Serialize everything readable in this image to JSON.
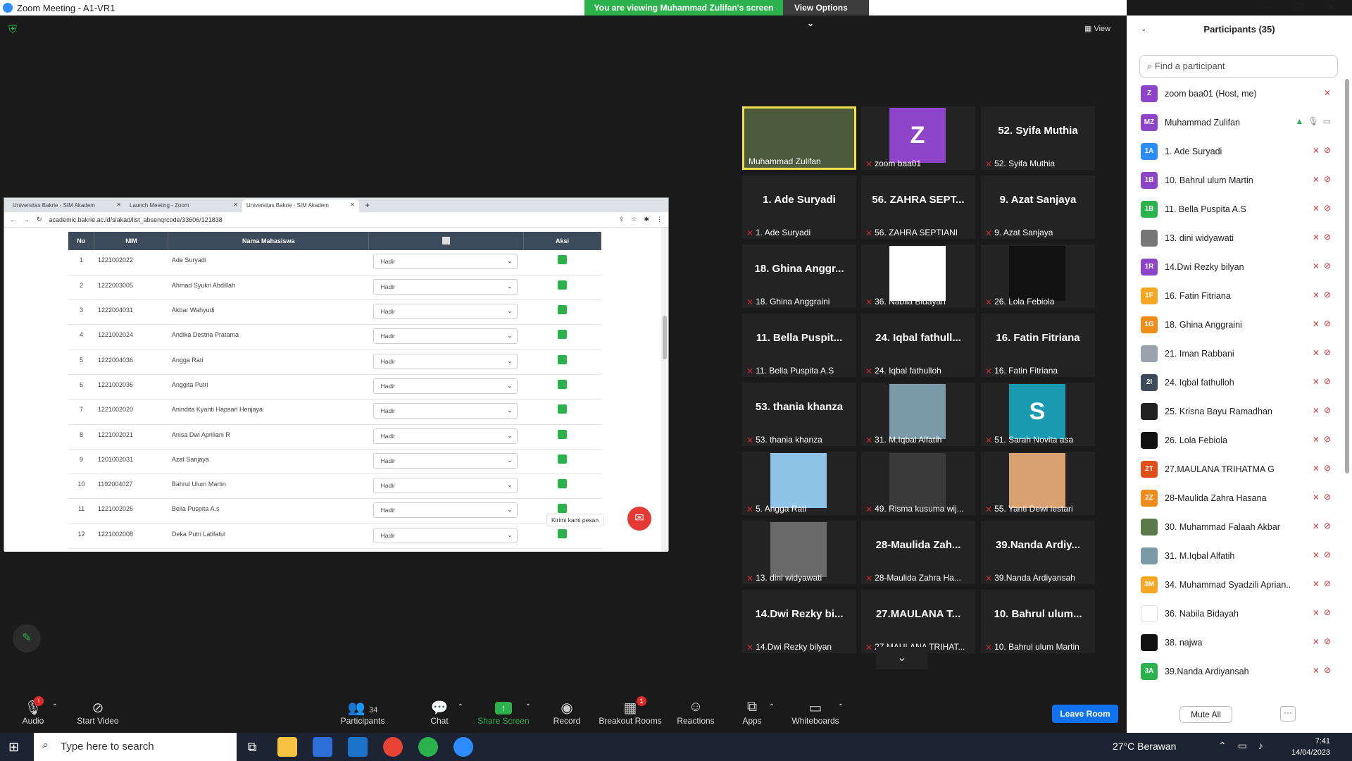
{
  "window": {
    "title": "Zoom Meeting - A1-VR1"
  },
  "share_bar": {
    "viewing_text": "You are viewing Muhammad Zulifan's screen",
    "view_options": "View Options"
  },
  "top_view_button": "View",
  "browser": {
    "tabs": [
      "Universitas Bakrie - SIM Akadem",
      "Launch Meeting - Zoom",
      "Universitas Bakrie - SIM Akadem"
    ],
    "url": "academic.bakrie.ac.id/siakad/list_absenqrcode/33606/121838",
    "table_headers": [
      "No",
      "NIM",
      "Nama Mahasiswa",
      "",
      "Aksi"
    ],
    "rows": [
      {
        "no": "1",
        "nim": "1221002022",
        "nama": "Ade Suryadi",
        "status": "Hadir"
      },
      {
        "no": "2",
        "nim": "1222003005",
        "nama": "Ahmad Syukri Abdillah",
        "status": "Hadir"
      },
      {
        "no": "3",
        "nim": "1222004031",
        "nama": "Akbar Wahyudi",
        "status": "Hadir"
      },
      {
        "no": "4",
        "nim": "1221002024",
        "nama": "Andika Destria Pratama",
        "status": "Hadir"
      },
      {
        "no": "5",
        "nim": "1222004036",
        "nama": "Angga Rati",
        "status": "Hadir"
      },
      {
        "no": "6",
        "nim": "1221002036",
        "nama": "Anggita Putri",
        "status": "Hadir"
      },
      {
        "no": "7",
        "nim": "1221002020",
        "nama": "Anindita Kyanti Hapsari Henjaya",
        "status": "Hadir"
      },
      {
        "no": "8",
        "nim": "1221002021",
        "nama": "Anisa Dwi Apriliani R",
        "status": "Hadir"
      },
      {
        "no": "9",
        "nim": "1201002031",
        "nama": "Azat Sanjaya",
        "status": "Hadir"
      },
      {
        "no": "10",
        "nim": "1192004027",
        "nama": "Bahrul Ulum Martin",
        "status": "Hadir"
      },
      {
        "no": "11",
        "nim": "1221002026",
        "nama": "Bella Puspita A.s",
        "status": "Hadir"
      },
      {
        "no": "12",
        "nim": "1221002008",
        "nama": "Deka Putri Latifatul",
        "status": "Hadir"
      }
    ],
    "chat_tooltip": "Kirimi kami pesan"
  },
  "video_tiles": [
    {
      "big": "",
      "label": "Muhammad Zulifan",
      "kind": "photo",
      "color": "#4a5a3a"
    },
    {
      "big": "Z",
      "label": "zoom baa01",
      "kind": "avatar",
      "color": "#8e44c9"
    },
    {
      "big": "52. Syifa Muthia",
      "label": "52. Syifa Muthia",
      "kind": "name"
    },
    {
      "big": "1. Ade Suryadi",
      "label": "1. Ade Suryadi",
      "kind": "name"
    },
    {
      "big": "56. ZAHRA SEPT...",
      "label": "56. ZAHRA SEPTIANI",
      "kind": "name"
    },
    {
      "big": "9. Azat Sanjaya",
      "label": "9. Azat Sanjaya",
      "kind": "name"
    },
    {
      "big": "18. Ghina Anggr...",
      "label": "18. Ghina Anggraini",
      "kind": "name"
    },
    {
      "big": "",
      "label": "36. Nabila Bidayah",
      "kind": "photo",
      "color": "#ffffff"
    },
    {
      "big": "",
      "label": "26. Lola Febiola",
      "kind": "photo",
      "color": "#111111"
    },
    {
      "big": "11. Bella Puspit...",
      "label": "11. Bella Puspita A.S",
      "kind": "name"
    },
    {
      "big": "24. Iqbal fathull...",
      "label": "24. Iqbal fathulloh",
      "kind": "name"
    },
    {
      "big": "16. Fatin Fitriana",
      "label": "16. Fatin Fitriana",
      "kind": "name"
    },
    {
      "big": "53. thania khanza",
      "label": "53. thania khanza",
      "kind": "name"
    },
    {
      "big": "",
      "label": "31. M.Iqbal Alfatih",
      "kind": "photo",
      "color": "#7a9aa8"
    },
    {
      "big": "S",
      "label": "51. Sarah Novita asa",
      "kind": "avatar",
      "color": "#1a9ab0"
    },
    {
      "big": "",
      "label": "5. Angga Rati",
      "kind": "photo",
      "color": "#8fc3e8"
    },
    {
      "big": "",
      "label": "49. Risma kusuma wij...",
      "kind": "photo",
      "color": "#3a3a3a"
    },
    {
      "big": "",
      "label": "55. Yanti Dewi lestari",
      "kind": "photo",
      "color": "#d9a070"
    },
    {
      "big": "",
      "label": "13. dini widyawati",
      "kind": "photo",
      "color": "#6a6a6a"
    },
    {
      "big": "28-Maulida Zah...",
      "label": "28-Maulida Zahra Ha...",
      "kind": "name"
    },
    {
      "big": "39.Nanda Ardiy...",
      "label": "39.Nanda Ardiyansah",
      "kind": "name"
    },
    {
      "big": "14.Dwi Rezky bi...",
      "label": "14.Dwi Rezky bilyan",
      "kind": "name"
    },
    {
      "big": "27.MAULANA T...",
      "label": "27.MAULANA TRIHAT...",
      "kind": "name"
    },
    {
      "big": "10. Bahrul ulum...",
      "label": "10. Bahrul ulum Martin",
      "kind": "name"
    }
  ],
  "participants_panel": {
    "title": "Participants (35)",
    "search_placeholder": "Find a participant",
    "mute_all": "Mute All",
    "more": "···",
    "list": [
      {
        "initials": "Z",
        "name": "zoom baa01 (Host, me)",
        "color": "#8e44c9"
      },
      {
        "initials": "MZ",
        "name": "Muhammad Zulifan",
        "color": "#8e44c9"
      },
      {
        "initials": "1A",
        "name": "1. Ade Suryadi",
        "color": "#2d8cff"
      },
      {
        "initials": "1B",
        "name": "10. Bahrul ulum Martin",
        "color": "#8e44c9"
      },
      {
        "initials": "1B",
        "name": "11. Bella Puspita A.S",
        "color": "#2bb24c"
      },
      {
        "initials": "",
        "name": "13. dini widyawati",
        "color": "#777777"
      },
      {
        "initials": "1R",
        "name": "14.Dwi Rezky bilyan",
        "color": "#8e44c9"
      },
      {
        "initials": "1F",
        "name": "16. Fatin Fitriana",
        "color": "#f5a623"
      },
      {
        "initials": "1G",
        "name": "18. Ghina Anggraini",
        "color": "#f08c1a"
      },
      {
        "initials": "",
        "name": "21. Iman Rabbani",
        "color": "#9aa3ad"
      },
      {
        "initials": "2I",
        "name": "24. Iqbal fathulloh",
        "color": "#3c4a5c"
      },
      {
        "initials": "",
        "name": "25. Krisna Bayu Ramadhan",
        "color": "#222222"
      },
      {
        "initials": "",
        "name": "26. Lola Febiola",
        "color": "#111111"
      },
      {
        "initials": "2T",
        "name": "27.MAULANA TRIHATMA G",
        "color": "#e04e1a"
      },
      {
        "initials": "2Z",
        "name": "28-Maulida Zahra Hasana",
        "color": "#f08c1a"
      },
      {
        "initials": "",
        "name": "30. Muhammad Falaah Akbar",
        "color": "#5a7a4a"
      },
      {
        "initials": "",
        "name": "31. M.Iqbal Alfatih",
        "color": "#7a9aa8"
      },
      {
        "initials": "3M",
        "name": "34. Muhammad Syadzili Aprian...",
        "color": "#f5a623"
      },
      {
        "initials": "",
        "name": "36. Nabila Bidayah",
        "color": "#ffffff"
      },
      {
        "initials": "",
        "name": "38. najwa",
        "color": "#111111"
      },
      {
        "initials": "3A",
        "name": "39.Nanda Ardiyansah",
        "color": "#2bb24c"
      }
    ]
  },
  "toolbar": {
    "audio": "Audio",
    "start_video": "Start Video",
    "participants": "Participants",
    "participants_count": "34",
    "chat": "Chat",
    "share_screen": "Share Screen",
    "record": "Record",
    "breakout_rooms": "Breakout Rooms",
    "breakout_badge": "1",
    "reactions": "Reactions",
    "apps": "Apps",
    "whiteboards": "Whiteboards",
    "leave_room": "Leave Room",
    "audio_badge": "!"
  },
  "taskbar": {
    "search_placeholder": "Type here to search",
    "weather": "27°C  Berawan",
    "time": "7:41",
    "date": "14/04/2023"
  }
}
